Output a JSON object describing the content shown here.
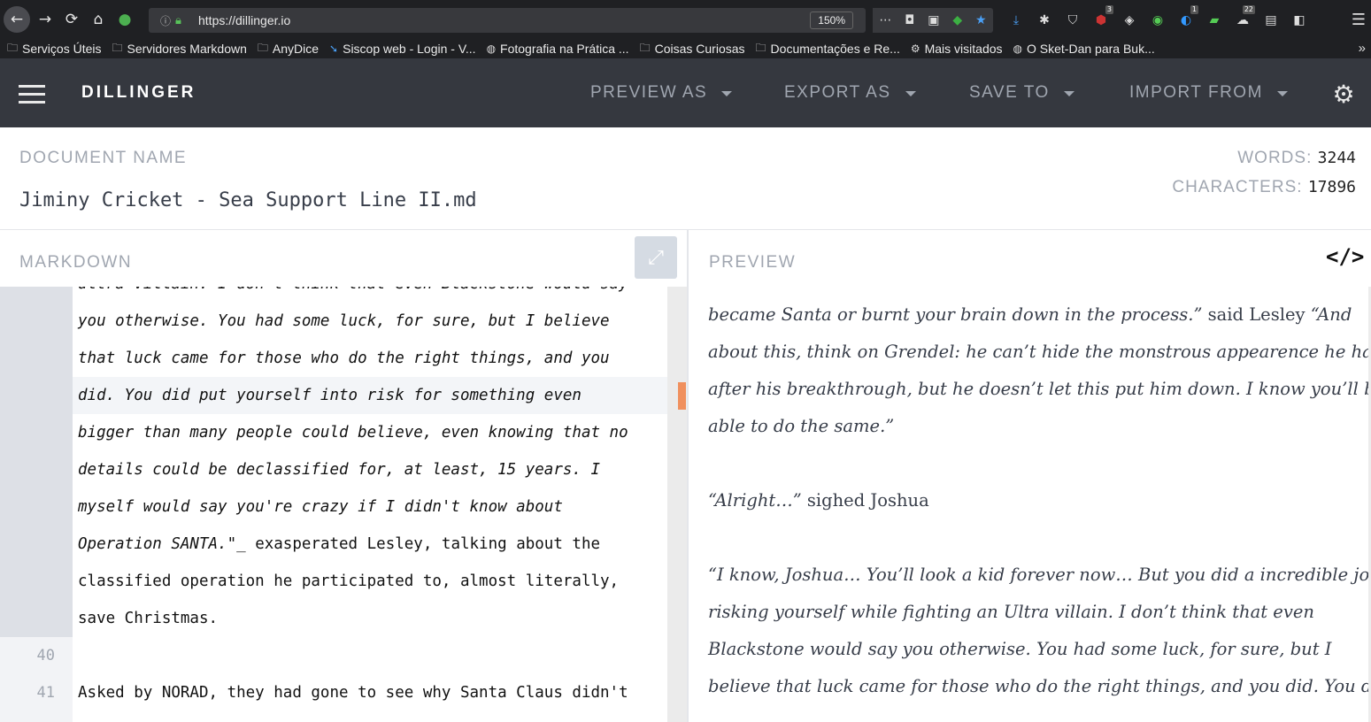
{
  "browser": {
    "url": "https://dillinger.io",
    "zoom": "150%",
    "bookmarks": [
      {
        "icon": "folder-icon",
        "label": "Serviços Úteis"
      },
      {
        "icon": "folder-icon",
        "label": "Servidores Markdown"
      },
      {
        "icon": "folder-icon",
        "label": "AnyDice"
      },
      {
        "icon": "link-icon",
        "label": "Siscop web - Login - V..."
      },
      {
        "icon": "globe-icon",
        "label": "Fotografia na Prática ..."
      },
      {
        "icon": "folder-icon",
        "label": "Coisas Curiosas"
      },
      {
        "icon": "folder-icon",
        "label": "Documentações e Re..."
      },
      {
        "icon": "gear-icon",
        "label": "Mais visitados"
      },
      {
        "icon": "globe-icon",
        "label": "O Sket-Dan para Buk..."
      }
    ],
    "extension_badges": {
      "ublock": "3",
      "ext2": "1",
      "weather": "22"
    }
  },
  "app": {
    "brand": "DILLINGER",
    "menu": {
      "preview_as": "PREVIEW AS",
      "export_as": "EXPORT AS",
      "save_to": "SAVE TO",
      "import_from": "IMPORT FROM"
    }
  },
  "document": {
    "label": "DOCUMENT NAME",
    "name": "Jiminy Cricket - Sea Support Line II.md",
    "words_label": "WORDS:",
    "words": "3244",
    "chars_label": "CHARACTERS:",
    "chars": "17896"
  },
  "markdown": {
    "title": "MARKDOWN",
    "line_numbers": {
      "l40": "40",
      "l41": "41"
    },
    "lines": [
      {
        "text": "ultra villain. I don't think that even Blackstone would say",
        "italic": true
      },
      {
        "text": "you otherwise. You had some luck, for sure, but I believe",
        "italic": true
      },
      {
        "text": "that luck came for those who do the right things, and you",
        "italic": true
      },
      {
        "text": "did. You did put yourself into risk for something even",
        "italic": true
      },
      {
        "text": "bigger than many people could believe, even knowing that no",
        "italic": true
      },
      {
        "text": "details could be declassified for, at least, 15 years. I",
        "italic": true
      },
      {
        "text": "myself would say you're crazy if I didn't know about",
        "italic": true
      },
      {
        "text_italic": "Operation SANTA.\"_",
        "text_plain": " exasperated Lesley, talking about the"
      },
      {
        "text": "classified operation he participated to, almost literally,",
        "italic": false
      },
      {
        "text": "save Christmas.",
        "italic": false
      },
      {
        "text": "",
        "italic": false
      },
      {
        "text": "Asked by NORAD, they had gone to see why Santa Claus didn't",
        "italic": false
      }
    ]
  },
  "preview": {
    "title": "PREVIEW",
    "toggle": "</>",
    "lines": {
      "l1_it": "became Santa or burnt your brain down in the process.”",
      "l1_plain": " said Lesley ",
      "l1_it2": "“And",
      "l2": "about this, think on Grendel: he can’t hide the monstrous appearence he has",
      "l3": "after his breakthrough, but he doesn’t let this put him down. I know you’ll be",
      "l4": "able to do the same.”",
      "l5_it": "“Alright…”",
      "l5_plain": " sighed Joshua",
      "l6": "“I know, Joshua… You’ll look a kid forever now… But you did a incredible job,",
      "l7": "risking yourself while fighting an Ultra villain. I don’t think that even",
      "l8": "Blackstone would say you otherwise. You had some luck, for sure, but I",
      "l9": "believe that luck came for those who do the right things, and you did. You did"
    }
  },
  "colors": {
    "navbar": "#35383f",
    "accent": "#f0905e",
    "muted": "#a0a6b0"
  }
}
